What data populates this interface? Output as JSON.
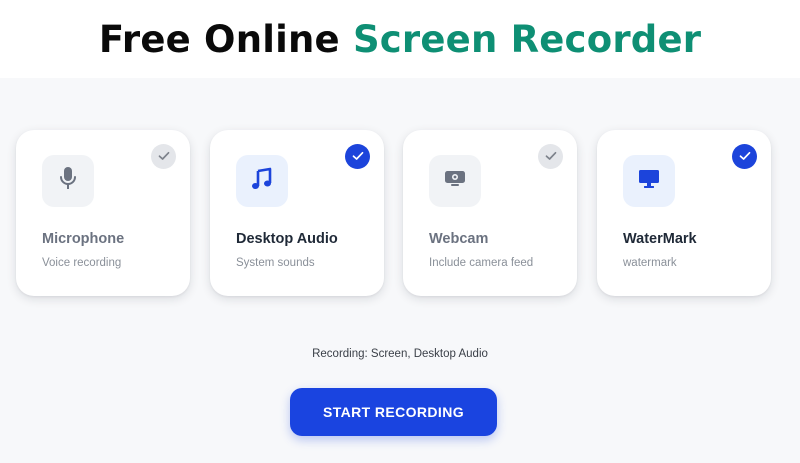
{
  "header": {
    "title_part1": "Free Online",
    "title_part2": "Screen Recorder"
  },
  "colors": {
    "accent_green": "#0e8f74",
    "primary_blue": "#1a44e0",
    "card_off_icon": "#6b7280"
  },
  "options": [
    {
      "label": "Microphone",
      "description": "Voice recording",
      "icon": "microphone-icon",
      "checked": false
    },
    {
      "label": "Desktop Audio",
      "description": "System sounds",
      "icon": "music-note-icon",
      "checked": true
    },
    {
      "label": "Webcam",
      "description": "Include camera feed",
      "icon": "webcam-icon",
      "checked": false
    },
    {
      "label": "WaterMark",
      "description": "watermark",
      "icon": "monitor-icon",
      "checked": true
    }
  ],
  "status": {
    "text": "Recording: Screen, Desktop Audio"
  },
  "actions": {
    "start_label": "START RECORDING"
  }
}
